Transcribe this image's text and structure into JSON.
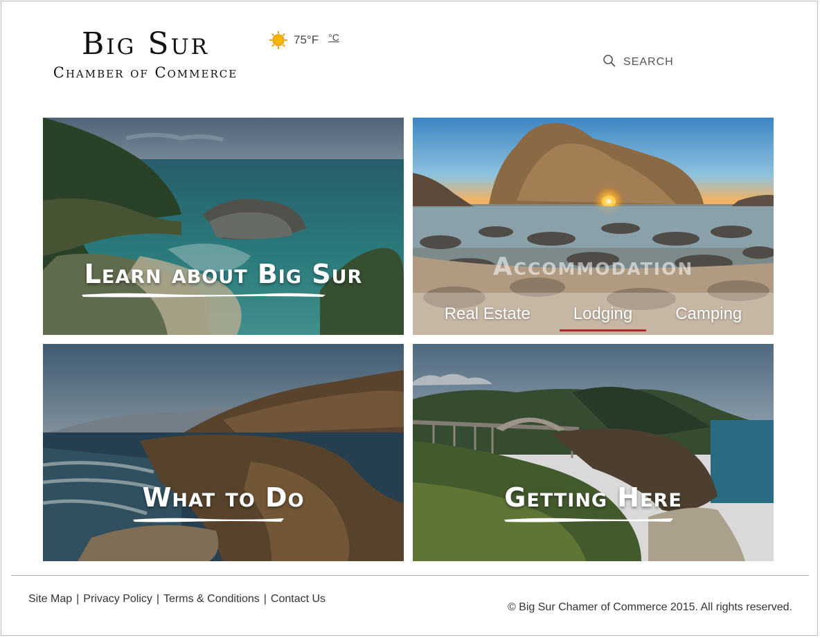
{
  "header": {
    "logo_title": "Big Sur",
    "logo_subtitle": "Chamber of Commerce",
    "weather": {
      "temperature": "75°F",
      "alt_unit": "°C",
      "icon": "sun-icon"
    },
    "search_label": "SEARCH"
  },
  "tiles": [
    {
      "title": "Learn about Big Sur"
    },
    {
      "title": "Accommodation",
      "subnav": [
        "Real Estate",
        "Lodging",
        "Camping"
      ],
      "active_subnav": "Lodging"
    },
    {
      "title": "What to Do"
    },
    {
      "title": "Getting Here"
    }
  ],
  "footer": {
    "links": [
      "Site Map",
      "Privacy Policy",
      "Terms & Conditions",
      "Contact Us"
    ],
    "copyright": "© Big Sur Chamer of Commerce 2015. All rights reserved."
  },
  "colors": {
    "active_underline": "#b0282a",
    "sun": "#f5a300"
  }
}
